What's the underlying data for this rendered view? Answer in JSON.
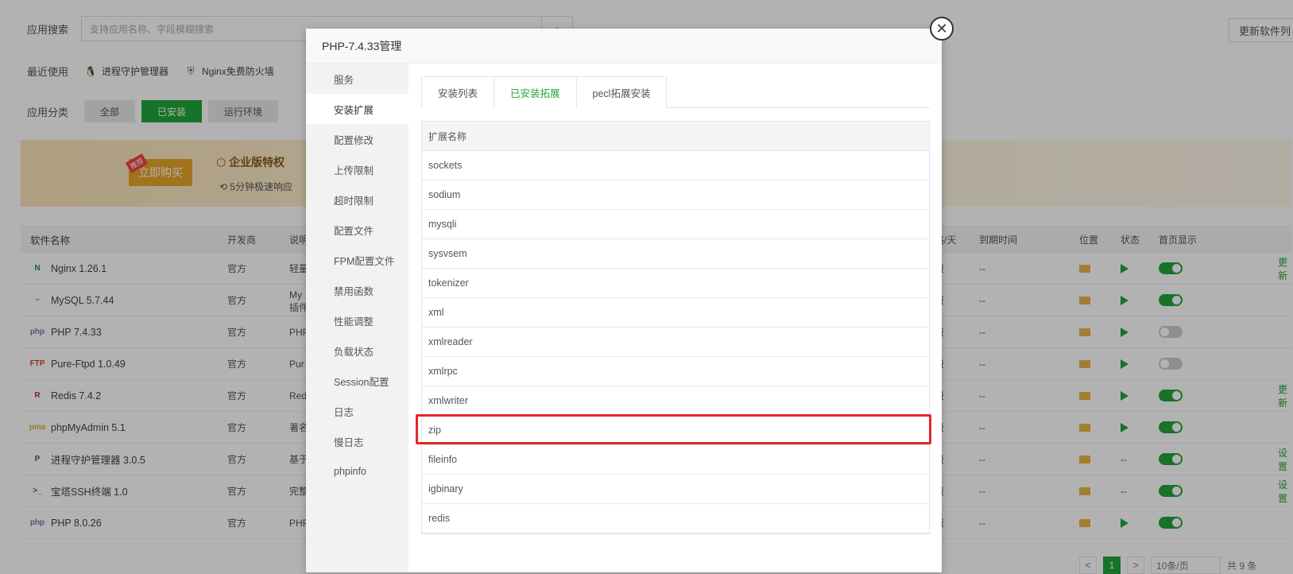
{
  "background": {
    "search_label": "应用搜索",
    "search_placeholder": "支持应用名称、字段模糊搜索",
    "update_button": "更新软件列",
    "recent_label": "最近使用",
    "recent_items": [
      "进程守护管理器",
      "Nginx免费防火墙"
    ],
    "category_label": "应用分类",
    "categories": [
      "全部",
      "已安装",
      "运行环境"
    ],
    "banner": {
      "buy_tag": "推荐",
      "buy_label": "立即购买",
      "title": "企业版特权",
      "subtitle": "5分钟极速响应"
    },
    "table": {
      "headers": {
        "name": "软件名称",
        "dev": "开发商",
        "desc": "说明",
        "price": "格/天",
        "expire": "到期时间",
        "loc": "位置",
        "stat": "状态",
        "home": "首页显示"
      },
      "rows": [
        {
          "name": "Nginx 1.26.1",
          "icon": "N",
          "icon_color": "#1e8d3c",
          "dev": "官方",
          "desc": "轻量",
          "price": "费",
          "expire": "--",
          "play": true,
          "toggle": true,
          "op": "更新"
        },
        {
          "name": "MySQL 5.7.44",
          "icon": "~",
          "icon_color": "#7a8aa0",
          "dev": "官方",
          "desc": "My",
          "desc2": "插件",
          "price": "费",
          "expire": "--",
          "play": true,
          "toggle": true,
          "op": ""
        },
        {
          "name": "PHP 7.4.33",
          "icon": "php",
          "icon_color": "#6b7bb3",
          "dev": "官方",
          "desc": "PHP",
          "price": "费",
          "expire": "--",
          "play": true,
          "toggle": false,
          "op": ""
        },
        {
          "name": "Pure-Ftpd 1.0.49",
          "icon": "FTP",
          "icon_color": "#d04a2a",
          "dev": "官方",
          "desc": "Pur",
          "price": "费",
          "expire": "--",
          "play": true,
          "toggle": false,
          "op": ""
        },
        {
          "name": "Redis 7.4.2",
          "icon": "R",
          "icon_color": "#c6302b",
          "dev": "官方",
          "desc": "Red",
          "price": "费",
          "expire": "--",
          "play": true,
          "toggle": true,
          "op": "更新"
        },
        {
          "name": "phpMyAdmin 5.1",
          "icon": "pma",
          "icon_color": "#e8a73c",
          "dev": "官方",
          "desc": "著名",
          "price": "费",
          "expire": "--",
          "play": true,
          "toggle": true,
          "op": ""
        },
        {
          "name": "进程守护管理器 3.0.5",
          "icon": "P",
          "icon_color": "#2b5f8f",
          "dev": "官方",
          "desc": "基于",
          "price": "费",
          "expire": "--",
          "play": false,
          "toggle": true,
          "op": "设置"
        },
        {
          "name": "宝塔SSH终端 1.0",
          "icon": ">_",
          "icon_color": "#1e7b3a",
          "dev": "官方",
          "desc": "完整",
          "price": "费",
          "expire": "--",
          "play": false,
          "toggle": true,
          "op": "设置"
        },
        {
          "name": "PHP 8.0.26",
          "icon": "php",
          "icon_color": "#6b7bb3",
          "dev": "官方",
          "desc": "PHP",
          "price": "费",
          "expire": "--",
          "play": true,
          "toggle": true,
          "op": ""
        }
      ]
    },
    "pager": {
      "prev": "<",
      "current": "1",
      "next": ">",
      "per_page": "10条/页",
      "total": "共 9 条"
    }
  },
  "modal": {
    "title": "PHP-7.4.33管理",
    "close_symbol": "✕",
    "menu": [
      "服务",
      "安装扩展",
      "配置修改",
      "上传限制",
      "超时限制",
      "配置文件",
      "FPM配置文件",
      "禁用函数",
      "性能调整",
      "负载状态",
      "Session配置",
      "日志",
      "慢日志",
      "phpinfo"
    ],
    "active_menu": 1,
    "tabs": [
      "安装列表",
      "已安装拓展",
      "pecl拓展安装"
    ],
    "active_tab": 1,
    "ext_header": "扩展名称",
    "extensions": [
      "sockets",
      "sodium",
      "mysqli",
      "sysvsem",
      "tokenizer",
      "xml",
      "xmlreader",
      "xmlrpc",
      "xmlwriter",
      "zip",
      "fileinfo",
      "igbinary",
      "redis"
    ],
    "highlighted_extension": "zip",
    "highlight_color": "#e3262a"
  }
}
